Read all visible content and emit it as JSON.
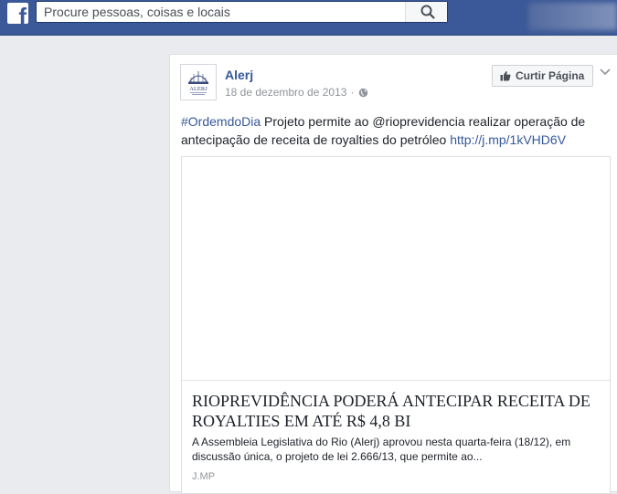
{
  "topbar": {
    "logo": "f",
    "search": {
      "placeholder": "Procure pessoas, coisas e locais",
      "value": "",
      "icon": "search-icon"
    }
  },
  "post": {
    "page_name": "Alerj",
    "avatar_label": "ALERJ",
    "date": "18 de dezembro de 2013",
    "date_separator": "·",
    "privacy_icon": "globe-icon",
    "like_button": "Curtir Página",
    "text": {
      "hashtag": "#OrdemdoDia",
      "body": " Projeto permite ao @rioprevidencia realizar operação de antecipação de receita de royalties do petróleo ",
      "link": "http://j.mp/1kVHD6V"
    },
    "link_preview": {
      "title": "RIOPREVIDÊNCIA PODERÁ ANTECIPAR RECEITA DE ROYALTIES EM ATÉ R$ 4,8 BI",
      "description": "A Assembleia Legislativa do Rio (Alerj) aprovou nesta quarta-feira (18/12), em discussão única, o projeto de lei 2.666/13, que permite ao...",
      "domain": "J.MP"
    }
  },
  "colors": {
    "brand": "#3b5998",
    "link": "#365899",
    "background": "#e9ebee"
  }
}
